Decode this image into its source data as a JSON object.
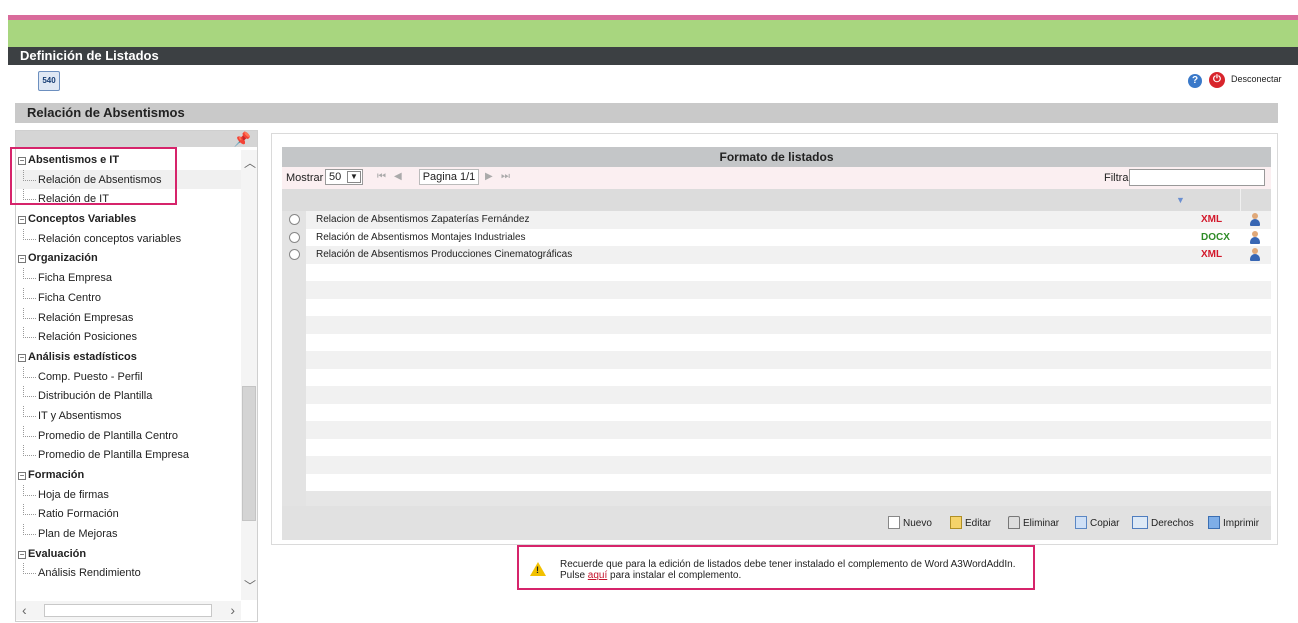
{
  "window": {
    "title": "Definición de Listados"
  },
  "toolbar": {
    "app_icon_text": "540",
    "disconnect_label": "Desconectar",
    "help_icon": "?",
    "power_icon": "⏻"
  },
  "section": {
    "title": "Relación de Absentismos"
  },
  "sidebar": {
    "groups": [
      {
        "label": "Absentismos e IT",
        "items": [
          "Relación de Absentismos",
          "Relación de IT"
        ]
      },
      {
        "label": "Conceptos Variables",
        "items": [
          "Relación conceptos variables"
        ]
      },
      {
        "label": "Organización",
        "items": [
          "Ficha Empresa",
          "Ficha Centro",
          "Relación Empresas",
          "Relación Posiciones"
        ]
      },
      {
        "label": "Análisis estadísticos",
        "items": [
          "Comp. Puesto - Perfil",
          "Distribución de Plantilla",
          "IT y Absentismos",
          "Promedio de Plantilla Centro",
          "Promedio de Plantilla Empresa"
        ]
      },
      {
        "label": "Formación",
        "items": [
          "Hoja de firmas",
          "Ratio Formación",
          "Plan de Mejoras"
        ]
      },
      {
        "label": "Evaluación",
        "items": [
          "Análisis Rendimiento"
        ]
      }
    ]
  },
  "grid": {
    "title": "Formato de listados",
    "show_label": "Mostrar",
    "page_size": "50",
    "page_label": "Pagina 1/1",
    "filter_label": "Filtrar:",
    "filter_value": "",
    "rows": [
      {
        "name": "Relacion de Absentismos Zapaterías Fernández",
        "format": "XML",
        "color": "#d3182b"
      },
      {
        "name": "Relación de Absentismos Montajes  Industriales",
        "format": "DOCX",
        "color": "#2e8b26"
      },
      {
        "name": "Relación de Absentismos Producciones Cinematográficas",
        "format": "XML",
        "color": "#d3182b"
      }
    ],
    "actions": {
      "new": "Nuevo",
      "edit": "Editar",
      "delete": "Eliminar",
      "copy": "Copiar",
      "rights": "Derechos",
      "print": "Imprimir"
    }
  },
  "notice": {
    "line1": "Recuerde que para la edición de listados debe tener instalado el complemento de Word A3WordAddIn.",
    "line2_pre": "Pulse ",
    "line2_link": "aquí",
    "line2_post": " para instalar el complemento."
  }
}
